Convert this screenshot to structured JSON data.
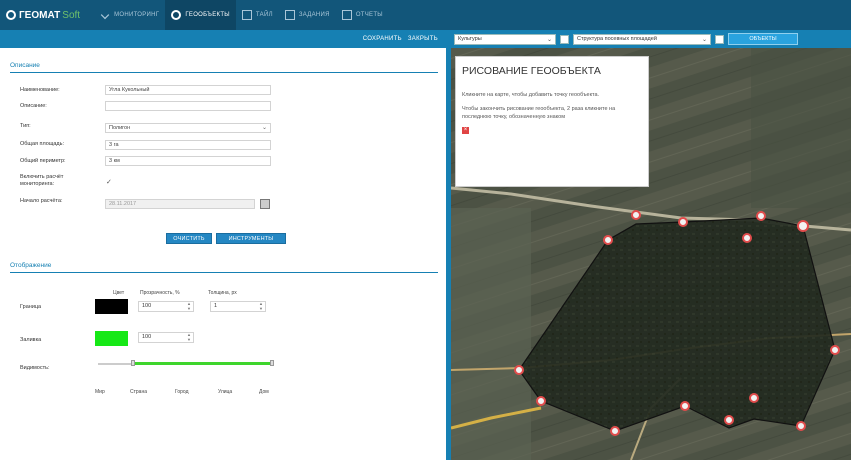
{
  "app": {
    "logo_main": "ГЕОМАТ",
    "logo_soft": "Soft"
  },
  "nav": [
    {
      "label": "МОНИТОРИНГ",
      "icon": "check-icon"
    },
    {
      "label": "ГЕООБЪЕКТЫ",
      "icon": "search-icon",
      "active": true
    },
    {
      "label": "ТАЙЛ",
      "icon": "tile-icon"
    },
    {
      "label": "ЗАДАНИЯ",
      "icon": "tasks-icon"
    },
    {
      "label": "ОТЧЕТЫ",
      "icon": "reports-icon"
    }
  ],
  "toolbar": {
    "save": "СОХРАНИТЬ",
    "close": "ЗАКРЫТЬ"
  },
  "map_toolbar": {
    "layer_select": "Культуры",
    "view_select": "Структура посевных площадей",
    "objects_button": "ОБЪЕКТЫ"
  },
  "description": {
    "section_title": "Описание",
    "fields": {
      "name_label": "Наименование:",
      "name_value": "Угла Кукольный",
      "desc_label": "Описание:",
      "type_label": "Тип:",
      "type_value": "Полигон",
      "area_label": "Общая площадь:",
      "area_value": "3 га",
      "perimeter_label": "Общий периметр:",
      "perimeter_value": "3 км",
      "include_label": "Включить расчёт мониторинга:",
      "date_label": "Начало расчёта:",
      "date_value": "28.11.2017"
    },
    "buttons": {
      "clear": "ОЧИСТИТЬ",
      "tools": "ИНСТРУМЕНТЫ"
    }
  },
  "display": {
    "section_title": "Отображение",
    "headers": {
      "color": "Цвет",
      "transparency": "Прозрачность, %",
      "thickness": "Толщина, px"
    },
    "border": {
      "label": "Граница",
      "color": "#000000",
      "transparency": "100",
      "thickness": "1"
    },
    "fill": {
      "label": "Заливка",
      "color": "#16e816",
      "transparency": "100"
    },
    "visibility": {
      "label": "Видимость:",
      "range": [
        0.2,
        1.0
      ],
      "ticks": [
        "Мир",
        "Страна",
        "Город",
        "Улица",
        "Дом"
      ]
    }
  },
  "popup": {
    "title": "РИСОВАНИЕ ГЕООБЪЕКТА",
    "line1": "Кликните на карте, чтобы добавить точку геообъекта.",
    "line2": "Чтобы закончить рисование геообъекта, 2 раза кликните на последнюю точку, обозначенную знаком",
    "close_icon": "×"
  }
}
